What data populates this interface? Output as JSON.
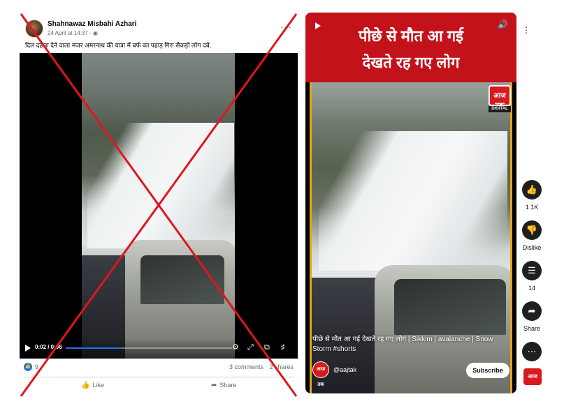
{
  "facebook": {
    "author": "Shahnawaz Misbahi Azhari",
    "timestamp": "24 April at 14:37 · ",
    "globe_icon": "globe-icon",
    "caption": "दिल दहला देने वाला मंजर अमरनाथ की यात्रा में बर्फ का पहाड़ गिरा  सैकड़ों लोग दबे.",
    "more_label": "···",
    "video": {
      "time": "0:02 / 0:06",
      "progress": 0.33
    },
    "reactions_count": "9",
    "comments": "3 comments",
    "shares": "2 shares",
    "like_label": "Like",
    "share_label": "Share"
  },
  "youtube": {
    "banner_line1": "पीछे से मौत आ गई",
    "banner_line2": "देखते रह गए लोग",
    "logo_text": "आज तक",
    "digital_label": "DIGITAL",
    "title": "पीछे से मौत आ गई देखते रह गए लोग | Sikkim | avalanche | Snow Storm #shorts",
    "channel": "@aajtak",
    "channel_avatar_text": "आज तक",
    "subscribe_label": "Subscribe",
    "likes": "1.1K",
    "dislike_label": "Dislike",
    "comments": "14",
    "share_label": "Share",
    "side_logo_text": "आज तक"
  },
  "colors": {
    "fb_blue": "#1b74e4",
    "cross_red": "#e0161c",
    "aajtak_red": "#c4121a",
    "frame_yellow": "#e6a616"
  }
}
